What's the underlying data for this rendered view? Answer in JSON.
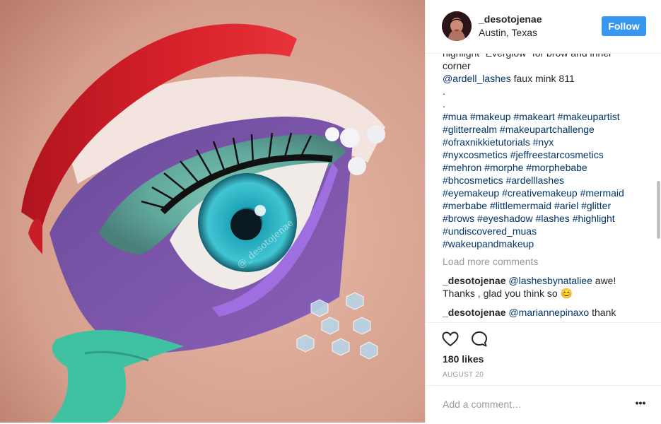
{
  "post": {
    "image_alt": "Mermaid eye makeup",
    "watermark": "@_desotojenae"
  },
  "header": {
    "username": "_desotojenae",
    "location": "Austin, Texas",
    "follow_label": "Follow"
  },
  "caption_lines": [
    {
      "parts": [
        {
          "text": "highlight “Everglow” for brow and inner",
          "tag": false
        }
      ]
    },
    {
      "parts": [
        {
          "text": "corner",
          "tag": false
        }
      ]
    },
    {
      "parts": [
        {
          "text": "@ardell_lashes",
          "tag": true
        },
        {
          "text": " faux mink 811",
          "tag": false
        }
      ]
    },
    {
      "parts": [
        {
          "text": ".",
          "tag": false
        }
      ]
    },
    {
      "parts": [
        {
          "text": ".",
          "tag": false
        }
      ]
    },
    {
      "parts": [
        {
          "text": "#mua",
          "tag": true
        },
        {
          "text": " ",
          "tag": false
        },
        {
          "text": "#makeup",
          "tag": true
        },
        {
          "text": " ",
          "tag": false
        },
        {
          "text": "#makeart",
          "tag": true
        },
        {
          "text": " ",
          "tag": false
        },
        {
          "text": "#makeupartist",
          "tag": true
        }
      ]
    },
    {
      "parts": [
        {
          "text": "#glitterrealm",
          "tag": true
        },
        {
          "text": " ",
          "tag": false
        },
        {
          "text": "#makeupartchallenge",
          "tag": true
        }
      ]
    },
    {
      "parts": [
        {
          "text": "#ofraxnikkietutorials",
          "tag": true
        },
        {
          "text": " ",
          "tag": false
        },
        {
          "text": "#nyx",
          "tag": true
        }
      ]
    },
    {
      "parts": [
        {
          "text": "#nyxcosmetics",
          "tag": true
        },
        {
          "text": " ",
          "tag": false
        },
        {
          "text": "#jeffreestarcosmetics",
          "tag": true
        }
      ]
    },
    {
      "parts": [
        {
          "text": "#mehron",
          "tag": true
        },
        {
          "text": " ",
          "tag": false
        },
        {
          "text": "#morphe",
          "tag": true
        },
        {
          "text": " ",
          "tag": false
        },
        {
          "text": "#morphebabe",
          "tag": true
        }
      ]
    },
    {
      "parts": [
        {
          "text": "#bhcosmetics",
          "tag": true
        },
        {
          "text": " ",
          "tag": false
        },
        {
          "text": "#ardelllashes",
          "tag": true
        }
      ]
    },
    {
      "parts": [
        {
          "text": "#eyemakeup",
          "tag": true
        },
        {
          "text": " ",
          "tag": false
        },
        {
          "text": "#creativemakeup",
          "tag": true
        },
        {
          "text": " ",
          "tag": false
        },
        {
          "text": "#mermaid",
          "tag": true
        }
      ]
    },
    {
      "parts": [
        {
          "text": "#merbabe",
          "tag": true
        },
        {
          "text": " ",
          "tag": false
        },
        {
          "text": "#littlemermaid",
          "tag": true
        },
        {
          "text": " ",
          "tag": false
        },
        {
          "text": "#ariel",
          "tag": true
        },
        {
          "text": " ",
          "tag": false
        },
        {
          "text": "#glitter",
          "tag": true
        }
      ]
    },
    {
      "parts": [
        {
          "text": "#brows",
          "tag": true
        },
        {
          "text": " ",
          "tag": false
        },
        {
          "text": "#eyeshadow",
          "tag": true
        },
        {
          "text": " ",
          "tag": false
        },
        {
          "text": "#lashes",
          "tag": true
        },
        {
          "text": " ",
          "tag": false
        },
        {
          "text": "#highlight",
          "tag": true
        }
      ]
    },
    {
      "parts": [
        {
          "text": "#undiscovered_muas",
          "tag": true
        }
      ]
    },
    {
      "parts": [
        {
          "text": "#wakeupandmakeup",
          "tag": true
        }
      ]
    }
  ],
  "load_more_label": "Load more comments",
  "comments": [
    {
      "user": "_desotojenae",
      "mention": "@lashesbynataliee",
      "text": "awe!",
      "line2": "Thanks , glad you think so 😊"
    },
    {
      "user": "_desotojenae",
      "mention": "@mariannepinaxo",
      "text": "thank"
    }
  ],
  "actions": {
    "like_icon": "heart-icon",
    "comment_icon": "comment-bubble-icon"
  },
  "likes_text": "180 likes",
  "date_text": "AUGUST 20",
  "add_comment_placeholder": "Add a comment…",
  "more_label": "•••",
  "colors": {
    "follow_button": "#3897f0",
    "tag": "#003569",
    "muted": "#999999"
  }
}
